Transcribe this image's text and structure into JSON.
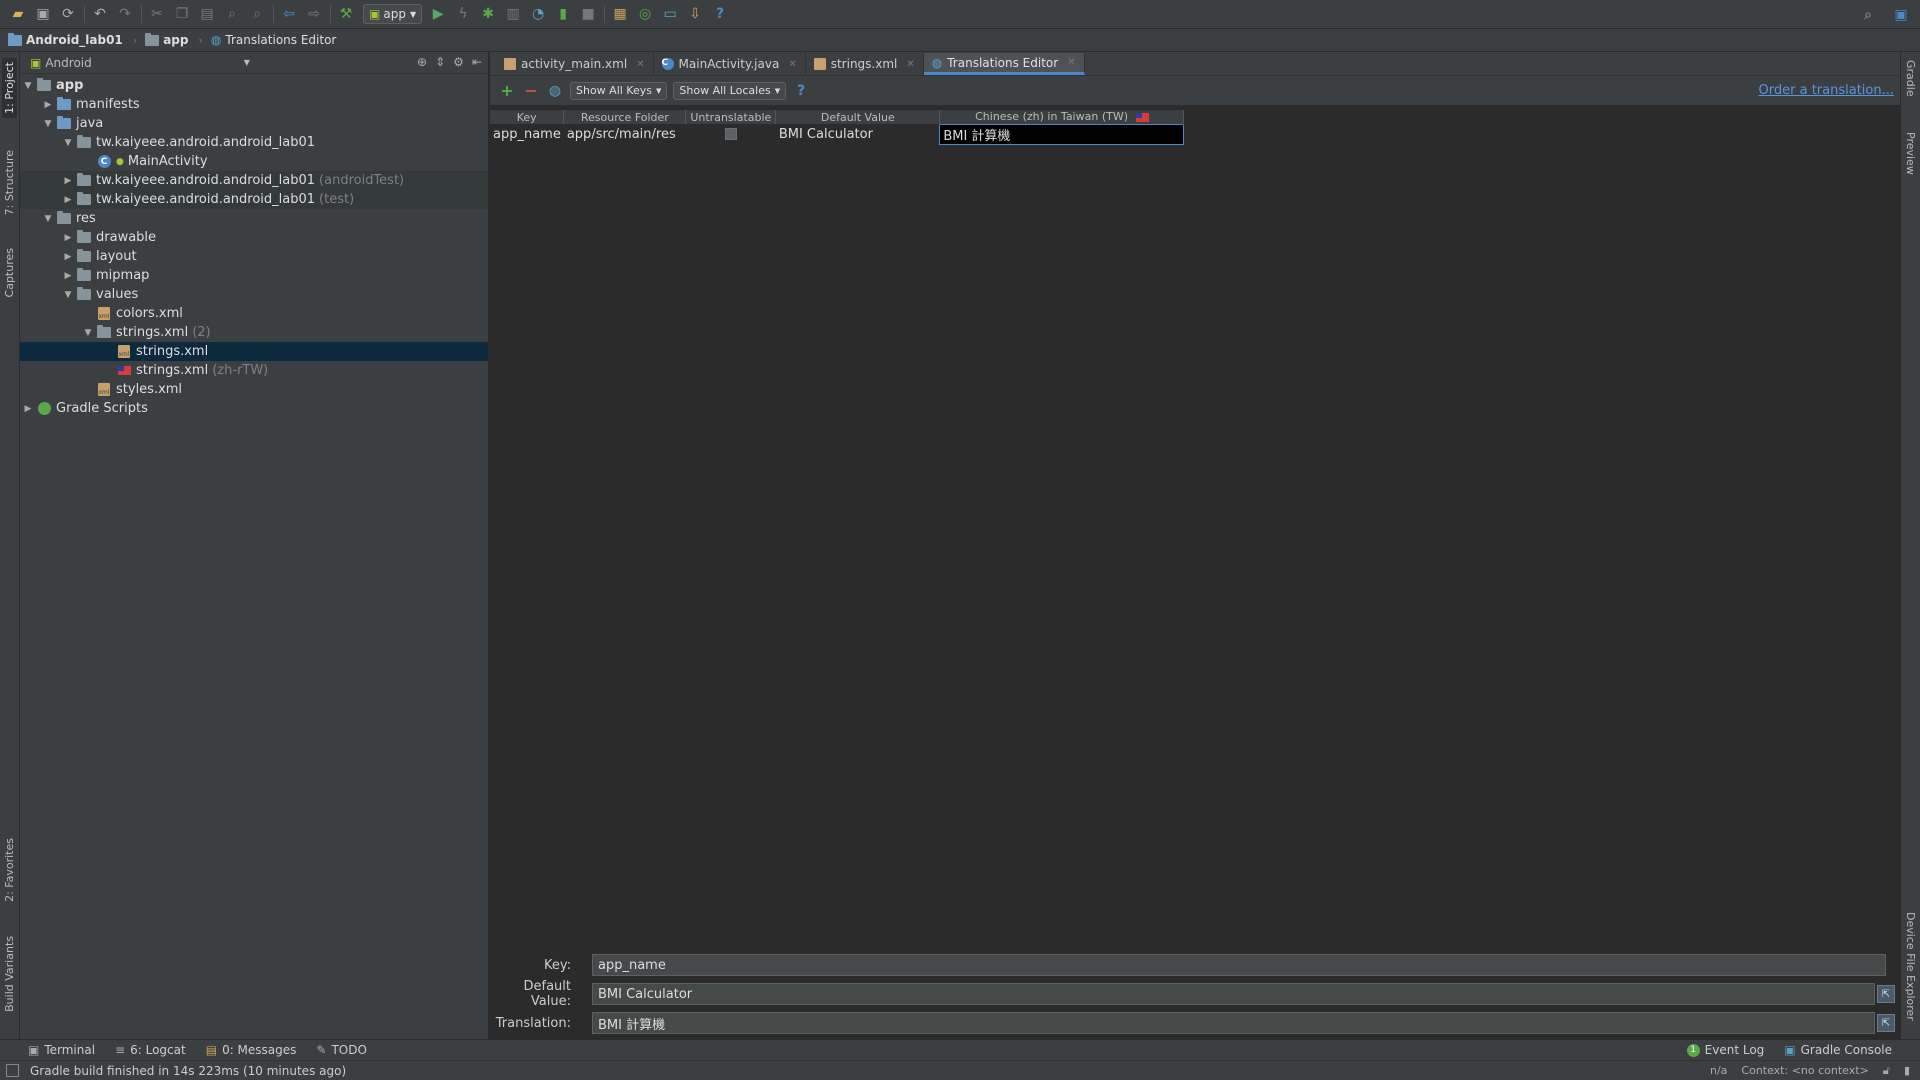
{
  "toolbar": {
    "run_config": "app"
  },
  "breadcrumb": {
    "project": "Android_lab01",
    "module": "app",
    "editor": "Translations Editor"
  },
  "left_stripe": {
    "project": "1: Project",
    "structure": "7: Structure",
    "captures": "Captures",
    "favorites": "2: Favorites",
    "build_variants": "Build Variants"
  },
  "right_stripe": {
    "gradle": "Gradle",
    "preview": "Preview",
    "device_explorer": "Device File Explorer"
  },
  "project_panel": {
    "view_mode": "Android",
    "tree": [
      {
        "label": "app",
        "suffix": ""
      },
      {
        "label": "manifests",
        "suffix": ""
      },
      {
        "label": "java",
        "suffix": ""
      },
      {
        "label": "tw.kaiyeee.android.android_lab01",
        "suffix": ""
      },
      {
        "label": "MainActivity",
        "suffix": ""
      },
      {
        "label": "tw.kaiyeee.android.android_lab01",
        "suffix": "(androidTest)"
      },
      {
        "label": "tw.kaiyeee.android.android_lab01",
        "suffix": "(test)"
      },
      {
        "label": "res",
        "suffix": ""
      },
      {
        "label": "drawable",
        "suffix": ""
      },
      {
        "label": "layout",
        "suffix": ""
      },
      {
        "label": "mipmap",
        "suffix": ""
      },
      {
        "label": "values",
        "suffix": ""
      },
      {
        "label": "colors.xml",
        "suffix": ""
      },
      {
        "label": "strings.xml",
        "suffix": "(2)"
      },
      {
        "label": "strings.xml",
        "suffix": ""
      },
      {
        "label": "strings.xml",
        "suffix": "(zh-rTW)"
      },
      {
        "label": "styles.xml",
        "suffix": ""
      },
      {
        "label": "Gradle Scripts",
        "suffix": ""
      }
    ]
  },
  "tabs": [
    {
      "label": "activity_main.xml"
    },
    {
      "label": "MainActivity.java"
    },
    {
      "label": "strings.xml"
    },
    {
      "label": "Translations Editor"
    }
  ],
  "translations_editor": {
    "show_keys": "Show All Keys",
    "show_locales": "Show All Locales",
    "order_link": "Order a translation...",
    "columns": [
      "Key",
      "Resource Folder",
      "Untranslatable",
      "Default Value",
      "Chinese (zh) in Taiwan (TW)"
    ],
    "rows": [
      {
        "key": "app_name",
        "folder": "app/src/main/res",
        "untranslatable": false,
        "default": "BMI Calculator",
        "translation": "BMI 計算機"
      }
    ],
    "form": {
      "key_label": "Key:",
      "key_value": "app_name",
      "default_label": "Default Value:",
      "default_value": "BMI Calculator",
      "translation_label": "Translation:",
      "translation_value": "BMI 計算機"
    }
  },
  "tool_windows": {
    "terminal": "Terminal",
    "logcat": "6: Logcat",
    "messages": "0: Messages",
    "todo": "TODO",
    "event_log": "Event Log",
    "gradle_console": "Gradle Console",
    "event_log_count": "1"
  },
  "status_bar": {
    "message": "Gradle build finished in 14s 223ms (10 minutes ago)",
    "position": "n/a",
    "context": "Context: <no context>"
  },
  "colors": {
    "accent": "#4a88c7",
    "link": "#5897e0",
    "selection": "#0d293e"
  }
}
